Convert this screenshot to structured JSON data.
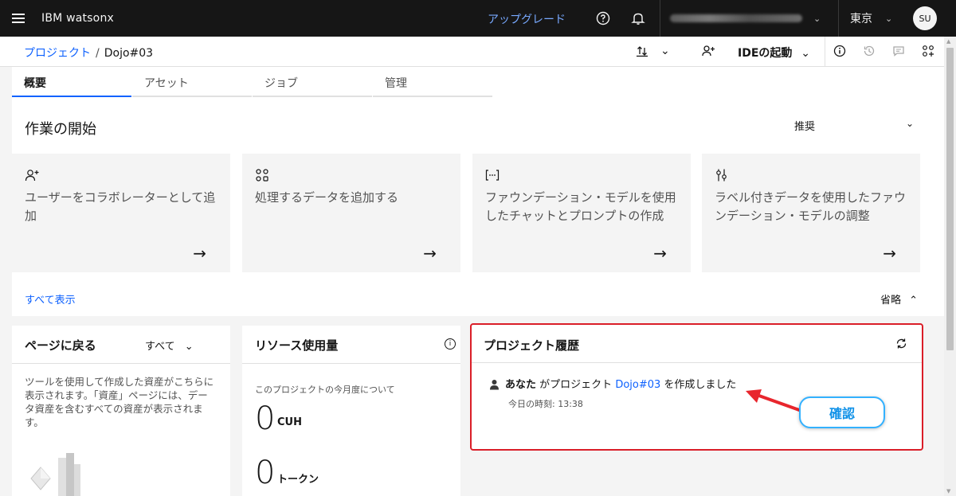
{
  "topbar": {
    "brand": "IBM watsonx",
    "upgrade": "アップグレード",
    "region": "東京",
    "avatar": "SU"
  },
  "breadcrumb": {
    "parent": "プロジェクト",
    "separator": "/",
    "current": "Dojo#03"
  },
  "toolbar": {
    "ide_label": "IDEの起動"
  },
  "tabs": [
    {
      "label": "概要"
    },
    {
      "label": "アセット"
    },
    {
      "label": "ジョブ"
    },
    {
      "label": "管理"
    }
  ],
  "getting_started": {
    "title": "作業の開始",
    "recommend": "推奨",
    "cards": [
      {
        "text": "ユーザーをコラボレーターとして追加",
        "icon": "add-user-icon"
      },
      {
        "text": "処理するデータを追加する",
        "icon": "data-icon"
      },
      {
        "text": "ファウンデーション・モデルを使用したチャットとプロンプトの作成",
        "icon": "code-brackets-icon"
      },
      {
        "text": "ラベル付きデータを使用したファウンデーション・モデルの調整",
        "icon": "sliders-icon"
      }
    ],
    "show_all": "すべて表示",
    "collapse": "省略"
  },
  "panels": {
    "back": {
      "title": "ページに戻る",
      "filter": "すべて",
      "text": "ツールを使用して作成した資産がこちらに表示されます。「資産」ページには、データ資産を含むすべての資産が表示されます。"
    },
    "resources": {
      "title": "リソース使用量",
      "label": "このプロジェクトの今月度について",
      "cuh_value": "0",
      "cuh_unit": "CUH",
      "token_value": "0",
      "token_unit": "トークン"
    },
    "history": {
      "title": "プロジェクト履歴",
      "actor": "あなた",
      "action_before": "がプロジェクト",
      "project_link": "Dojo#03",
      "action_after": "を作成しました",
      "time": "今日の時刻: 13:38"
    }
  },
  "annotation": {
    "callout": "確認",
    "accent": "#da1e28"
  }
}
